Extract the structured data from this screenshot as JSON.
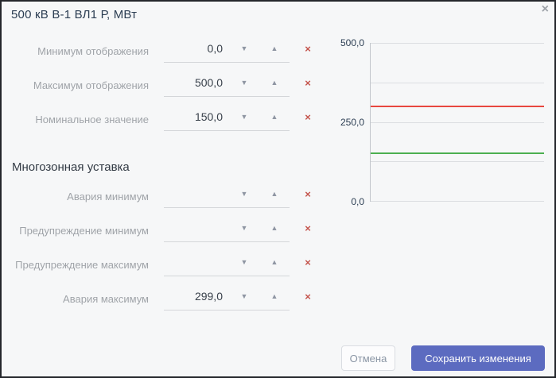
{
  "dialog": {
    "title": "500 кВ В-1 ВЛ1  Р, МВт",
    "section_title": "Многозонная уставка"
  },
  "icons": {
    "close": "×",
    "spinner_down": "▼",
    "spinner_up": "▲",
    "clear": "×"
  },
  "form": {
    "fields": [
      {
        "label": "Минимум отображения",
        "value": "0,0"
      },
      {
        "label": "Максимум отображения",
        "value": "500,0"
      },
      {
        "label": "Номинальное значение",
        "value": "150,0"
      }
    ],
    "zones": [
      {
        "label": "Авария минимум",
        "value": ""
      },
      {
        "label": "Предупреждение минимум",
        "value": ""
      },
      {
        "label": "Предупреждение максимум",
        "value": ""
      },
      {
        "label": "Авария максимум",
        "value": "299,0"
      }
    ]
  },
  "footer": {
    "cancel_label": "Отмена",
    "save_label": "Сохранить изменения"
  },
  "colors": {
    "accent": "#5c6bc0",
    "alarm_line": "#e8473f",
    "nominal_line": "#4caf50",
    "clear_icon": "#c4544c"
  },
  "chart_data": {
    "type": "line",
    "title": "",
    "xlabel": "",
    "ylabel": "",
    "ylim": [
      0,
      500
    ],
    "grid": true,
    "yticks": [
      {
        "value": 500,
        "label": "500,0"
      },
      {
        "value": 250,
        "label": "250,0"
      },
      {
        "value": 0,
        "label": "0,0"
      }
    ],
    "gridlines": [
      0,
      125,
      250,
      375,
      500
    ],
    "series": [
      {
        "name": "Авария максимум",
        "type": "hline",
        "value": 299,
        "color": "#e8473f"
      },
      {
        "name": "Номинальное значение",
        "type": "hline",
        "value": 150,
        "color": "#4caf50"
      }
    ]
  }
}
